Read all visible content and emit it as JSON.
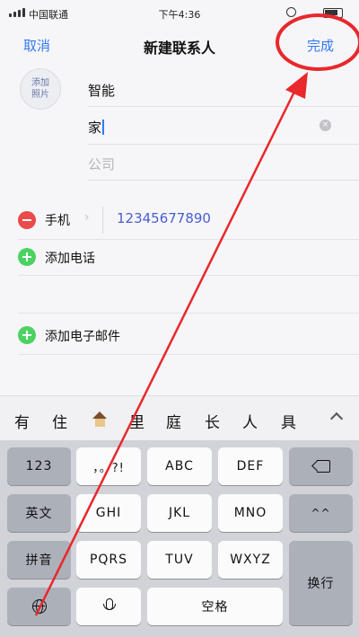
{
  "status_bar": {
    "carrier": "中国联通",
    "time": "下午4:36"
  },
  "nav": {
    "cancel": "取消",
    "title": "新建联系人",
    "done": "完成"
  },
  "photo": {
    "label_line1": "添加",
    "label_line2": "照片"
  },
  "fields": {
    "last_name": "智能",
    "first_name": "家",
    "company_placeholder": "公司"
  },
  "phone": {
    "label": "手机",
    "number": "12345677890"
  },
  "add_phone": "添加电话",
  "add_email": "添加电子邮件",
  "candidates": [
    "有",
    "住",
    "里",
    "庭",
    "长",
    "人",
    "具"
  ],
  "candidate_icons": [
    "house-icon"
  ],
  "keyboard": {
    "row1": {
      "fn_left": "123",
      "k1": "，。?!",
      "k2": "ABC",
      "k3": "DEF"
    },
    "row2": {
      "fn_left": "英文",
      "k1": "GHI",
      "k2": "JKL",
      "k3": "MNO",
      "fn_right": "^^"
    },
    "row3": {
      "fn_left": "拼音",
      "k1": "PQRS",
      "k2": "TUV",
      "k3": "WXYZ",
      "fn_right": "换行"
    },
    "row4": {
      "space": "空格"
    }
  },
  "colors": {
    "accent": "#3478f6",
    "delete": "#ea4a4a",
    "add": "#4cd263",
    "annotation": "#e8282b"
  }
}
